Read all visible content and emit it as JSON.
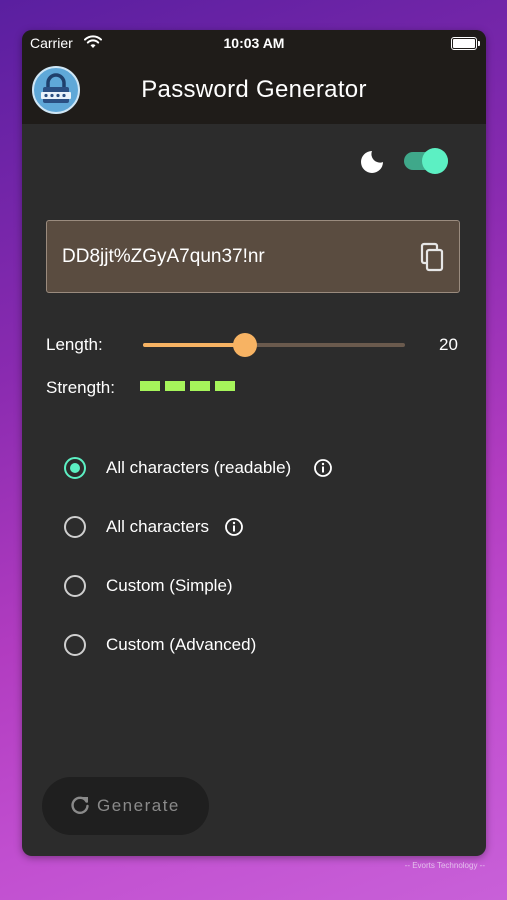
{
  "status_bar": {
    "carrier": "Carrier",
    "time": "10:03 AM"
  },
  "app": {
    "title": "Password Generator"
  },
  "theme": {
    "dark_mode": true
  },
  "password": {
    "value": "DD8jjt%ZGyA7qun37!nr"
  },
  "length": {
    "label": "Length:",
    "value": "20",
    "min": 1,
    "max": 50,
    "current": 20
  },
  "strength": {
    "label": "Strength:",
    "level": 4,
    "max": 4
  },
  "options": [
    {
      "label": "All characters (readable)",
      "selected": true,
      "has_info": true
    },
    {
      "label": "All characters",
      "selected": false,
      "has_info": true
    },
    {
      "label": "Custom (Simple)",
      "selected": false,
      "has_info": false
    },
    {
      "label": "Custom (Advanced)",
      "selected": false,
      "has_info": false
    }
  ],
  "generate": {
    "label": "Generate"
  },
  "footer": {
    "credit": "-- Evorts Technology --"
  },
  "colors": {
    "accent": "#5cf0c3",
    "slider": "#f7b363",
    "strength": "#a6f55b",
    "surface": "#2c2c2c",
    "appbar": "#1f1c19"
  }
}
